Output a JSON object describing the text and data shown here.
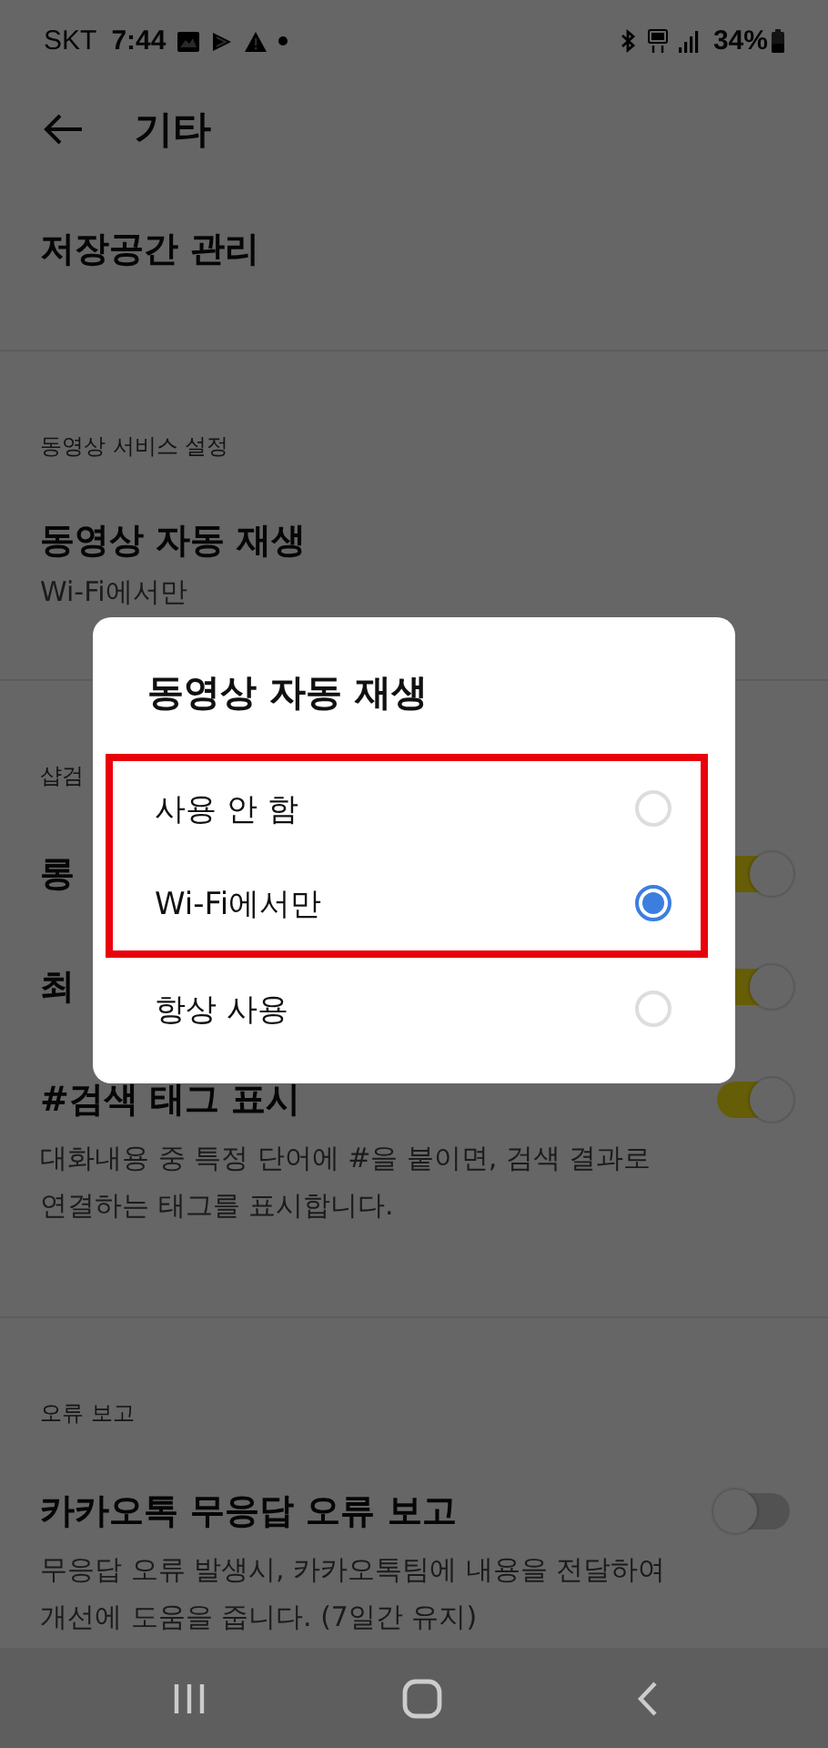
{
  "status_bar": {
    "carrier": "SKT",
    "time": "7:44",
    "battery": "34%"
  },
  "header": {
    "title": "기타"
  },
  "sections": [
    {
      "items": [
        {
          "kind": "link",
          "title": "저장공간 관리"
        }
      ]
    },
    {
      "header": "동영상 서비스 설정",
      "items": [
        {
          "kind": "link",
          "title": "동영상 자동 재생",
          "subtitle": "Wi-Fi에서만"
        }
      ]
    },
    {
      "header": "샵검",
      "items": [
        {
          "kind": "toggle",
          "title": "롱",
          "on": true
        },
        {
          "kind": "toggle",
          "title": "최",
          "on": true
        },
        {
          "kind": "toggle",
          "title": "#검색 태그 표시",
          "description": "대화내용 중 특정 단어에 #을 붙이면, 검색 결과로 연결하는 태그를 표시합니다.",
          "on": true
        }
      ]
    },
    {
      "header": "오류 보고",
      "items": [
        {
          "kind": "toggle",
          "title": "카카오톡 무응답 오류 보고",
          "description": "무응답 오류 발생시, 카카오톡팀에 내용을 전달하여 개선에 도움을 줍니다. (7일간 유지)",
          "on": false
        }
      ]
    }
  ],
  "dialog": {
    "title": "동영상 자동 재생",
    "options": [
      {
        "label": "사용 안 함",
        "selected": false,
        "highlighted": true
      },
      {
        "label": "Wi-Fi에서만",
        "selected": true,
        "highlighted": true
      },
      {
        "label": "항상 사용",
        "selected": false,
        "highlighted": false
      }
    ]
  }
}
